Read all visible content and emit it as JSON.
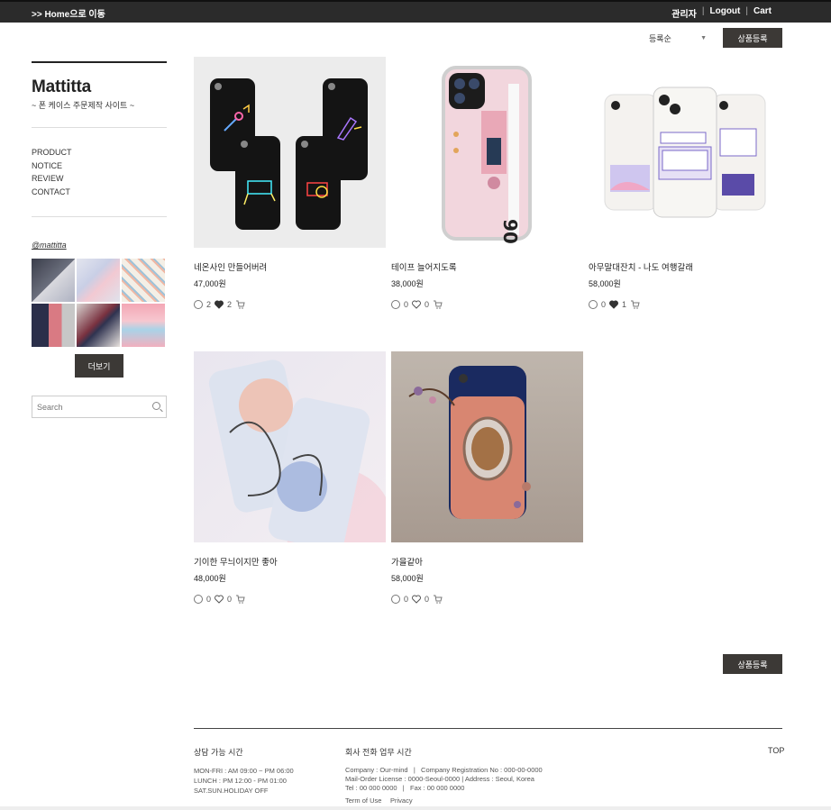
{
  "topbar": {
    "home": ">> Home으로 이동",
    "admin": "관리자",
    "logout": "Logout",
    "cart": "Cart",
    "sep": "|"
  },
  "sort": {
    "selected": "등록순"
  },
  "register_label": "상품등록",
  "sidebar": {
    "brand": "Mattitta",
    "tagline": "~ 폰 케이스 주문제작 사이트 ~",
    "menu": [
      "PRODUCT",
      "NOTICE",
      "REVIEW",
      "CONTACT"
    ],
    "insta_handle": "@mattitta",
    "more_label": "더보기",
    "search_placeholder": "Search"
  },
  "products": [
    {
      "name": "네온사인 만들어버려",
      "price": "47,000원",
      "comments": "2",
      "likes": "2",
      "liked": true
    },
    {
      "name": "테이프 늘어지도록",
      "price": "38,000원",
      "comments": "0",
      "likes": "0",
      "liked": false
    },
    {
      "name": "아무말대잔치 - 나도 여행갈래",
      "price": "58,000원",
      "comments": "0",
      "likes": "1",
      "liked": true
    },
    {
      "name": "기이한 무늬이지만 좋아",
      "price": "48,000원",
      "comments": "0",
      "likes": "0",
      "liked": false
    },
    {
      "name": "가을같아",
      "price": "58,000원",
      "comments": "0",
      "likes": "0",
      "liked": false
    }
  ],
  "footer": {
    "cs_title": "상담 가능 시간",
    "cs_lines": [
      "MON-FRI : AM 09:00 ~ PM 06:00",
      "LUNCH : PM 12:00 - PM 01:00",
      "SAT.SUN.HOLIDAY OFF"
    ],
    "co_title": "회사 전화 업무 시간",
    "co_lines": [
      "Company : Our-mind   |   Company Registration No : 000-00-0000",
      "Mail-Order License : 0000-Seoul-0000 | Address : Seoul, Korea",
      "Tel : 00 000 0000   |   Fax : 00 000 0000"
    ],
    "terms": "Term of Use",
    "privacy": "Privacy",
    "top": "TOP"
  },
  "colors": {
    "dark_button": "#3c3936",
    "topbar": "#2b2b2b"
  },
  "icons": [
    "comment-bubble-icon",
    "heart-icon",
    "cart-icon",
    "search-icon",
    "chevron-down-icon"
  ]
}
